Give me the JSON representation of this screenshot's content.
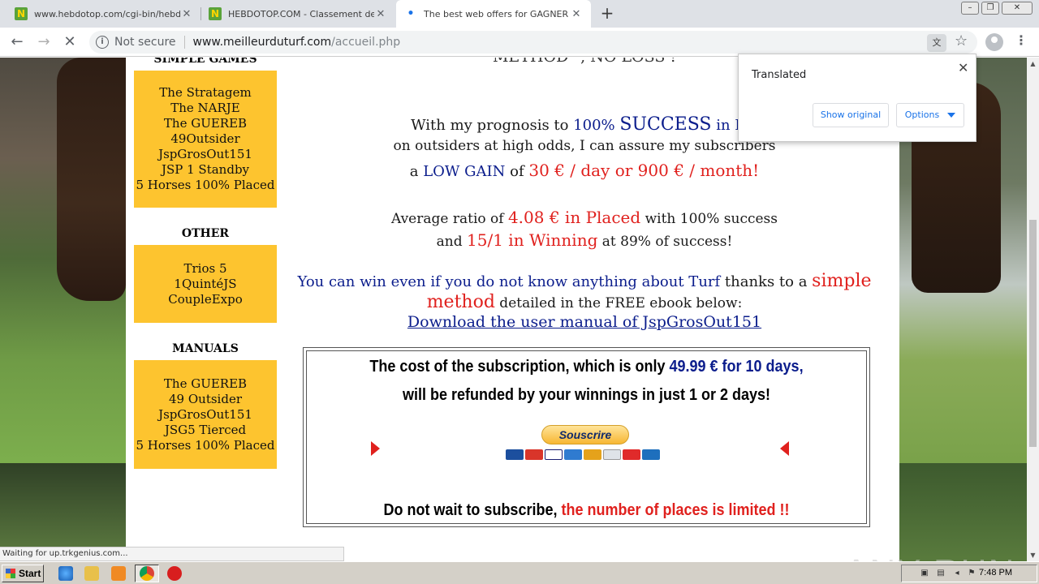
{
  "browser": {
    "tabs": [
      {
        "title": "www.hebdotop.com/cgi-bin/hebdoto",
        "favicon": "hebdotop-icon"
      },
      {
        "title": "HEBDOTOP.COM - Classement de sit",
        "favicon": "hebdotop-icon"
      },
      {
        "title": "The best web offers for GAGNER AU",
        "favicon": "loading-icon"
      }
    ],
    "security_label": "Not secure",
    "url_host": "www.meilleurduturf.com",
    "url_path": "/accueil.php",
    "status_text": "Waiting for up.trkgenius.com..."
  },
  "translate_popup": {
    "title": "Translated",
    "show_original": "Show original",
    "options": "Options"
  },
  "sidebar": {
    "simple_games_heading": "SIMPLE GAMES",
    "simple_games": [
      "The Stratagem",
      "The NARJE",
      "The GUEREB",
      "49Outsider",
      "JspGrosOut151",
      "JSP 1 Standby",
      "5 Horses 100% Placed"
    ],
    "other_heading": "OTHER",
    "other": [
      "Trios 5",
      "1QuintéJS",
      "CoupleExpo"
    ],
    "manuals_heading": "MANUALS",
    "manuals": [
      "The GUEREB",
      "49 Outsider",
      "JspGrosOut151",
      "JSG5 Tierced",
      "5 Horses 100% Placed"
    ]
  },
  "main": {
    "top_cut_text": "METHOD \", NO LOSS !",
    "l1_a": "With my prognosis to ",
    "l1_b": "100% ",
    "l1_c": "SUCCESS",
    "l1_d": " in Pla",
    "l2": "on outsiders at high odds, I can assure my subscribers",
    "l3_a": "a ",
    "l3_b": "LOW GAIN",
    "l3_c": " of ",
    "l3_d": "30 € / day or 900 € / month!",
    "l4_a": "Average ratio of ",
    "l4_b": "4.08 €",
    "l4_c": " in Placed",
    "l4_d": " with 100% success",
    "l5_a": "and ",
    "l5_b": "15/1",
    "l5_c": " in Winning",
    "l5_d": " at 89% of success!",
    "l6_a": "You can win even if you do not know anything about Turf",
    "l6_b": " thanks to a ",
    "l6_c": "simple",
    "l7_a": "method",
    "l7_b": " detailed in the FREE ebook below:",
    "download_link": "Download the user manual of JspGrosOut151",
    "cost_a": "The cost of the subscription, which is only ",
    "cost_b": "49.99 € for 10 days,",
    "cost_line2": "will be refunded by your winnings in just 1 or 2 days!",
    "subscribe": "Souscrire",
    "limit_a": "Do not wait to subscribe, ",
    "limit_b": "the number of places is limited !!"
  },
  "watermark": "ANY RUN",
  "taskbar": {
    "start": "Start",
    "clock": "7:48 PM"
  },
  "colors": {
    "accent_yellow": "#fdc42f",
    "navy": "#0b1d8c",
    "red": "#e0211e"
  }
}
